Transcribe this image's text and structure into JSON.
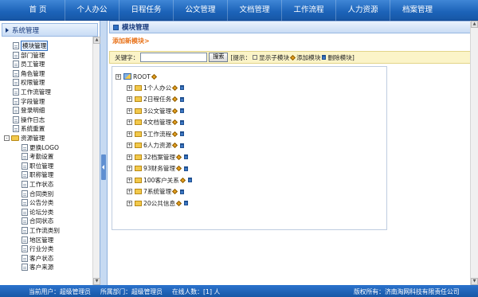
{
  "nav": {
    "items": [
      "首 页",
      "个人办公",
      "日程任务",
      "公文管理",
      "文档管理",
      "工作流程",
      "人力资源",
      "档案管理"
    ]
  },
  "sidebar": {
    "title": "系统管理",
    "items": [
      {
        "label": "模块管理",
        "level": 1,
        "type": "doc",
        "selected": true
      },
      {
        "label": "部门管理",
        "level": 1,
        "type": "doc"
      },
      {
        "label": "员工管理",
        "level": 1,
        "type": "doc"
      },
      {
        "label": "角色管理",
        "level": 1,
        "type": "doc"
      },
      {
        "label": "权限管理",
        "level": 1,
        "type": "doc"
      },
      {
        "label": "工作流管理",
        "level": 1,
        "type": "doc"
      },
      {
        "label": "字段管理",
        "level": 1,
        "type": "doc"
      },
      {
        "label": "登录明细",
        "level": 1,
        "type": "doc"
      },
      {
        "label": "操作日志",
        "level": 1,
        "type": "doc"
      },
      {
        "label": "系统重置",
        "level": 1,
        "type": "doc"
      },
      {
        "label": "资源管理",
        "level": 0,
        "type": "folder",
        "toggle": "-"
      },
      {
        "label": "更换LOGO",
        "level": 2,
        "type": "doc"
      },
      {
        "label": "考勤设置",
        "level": 2,
        "type": "doc"
      },
      {
        "label": "职位管理",
        "level": 2,
        "type": "doc"
      },
      {
        "label": "职称管理",
        "level": 2,
        "type": "doc"
      },
      {
        "label": "工作状态",
        "level": 2,
        "type": "doc"
      },
      {
        "label": "合同类别",
        "level": 2,
        "type": "doc"
      },
      {
        "label": "公告分类",
        "level": 2,
        "type": "doc"
      },
      {
        "label": "论坛分类",
        "level": 2,
        "type": "doc"
      },
      {
        "label": "合同状态",
        "level": 2,
        "type": "doc"
      },
      {
        "label": "工作流类别",
        "level": 2,
        "type": "doc"
      },
      {
        "label": "地区管理",
        "level": 2,
        "type": "doc"
      },
      {
        "label": "行业分类",
        "level": 2,
        "type": "doc"
      },
      {
        "label": "客户状态",
        "level": 2,
        "type": "doc"
      },
      {
        "label": "客户来源",
        "level": 2,
        "type": "doc"
      }
    ]
  },
  "main": {
    "panel_title": "模块管理",
    "add_link": "添加新模块>",
    "search": {
      "label": "关键字：",
      "button": "搜索",
      "hint_prefix": "[提示：",
      "hint_show": "显示子模块",
      "hint_add": "添加模块",
      "hint_delete": "删除模块]"
    },
    "tree": {
      "root": "ROOT",
      "nodes": [
        "1个人办公",
        "2日程任务",
        "3公文管理",
        "4文档管理",
        "5工作流程",
        "6人力资源",
        "32档案管理",
        "93财务管理",
        "100客户关系",
        "7系统管理",
        "20公共信息"
      ]
    }
  },
  "footer": {
    "current_user": "当前用户：超级管理员",
    "department": "所属部门：超级管理员",
    "online": "在线人数：[1] 人",
    "copyright": "版权所有：济南淘网科技有限责任公司"
  }
}
